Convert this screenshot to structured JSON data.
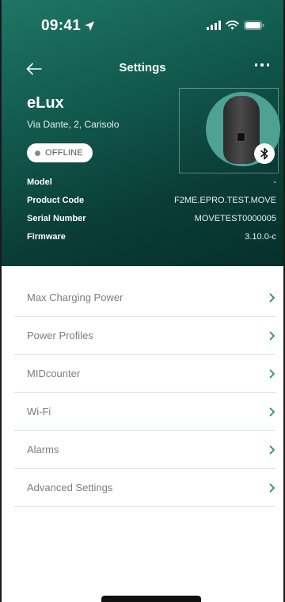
{
  "status_bar": {
    "time": "09:41",
    "icons": [
      "location-arrow-icon",
      "signal-icon",
      "wifi-icon",
      "battery-icon"
    ]
  },
  "navbar": {
    "title": "Settings",
    "back_icon": "back-arrow-icon",
    "more_icon": "more-dots-icon"
  },
  "device": {
    "name": "eLux",
    "address": "Via Dante, 2, Carisolo",
    "status": "OFFLINE",
    "status_color": "#8a8a8a",
    "badge_icon": "bluetooth-icon",
    "specs": [
      {
        "label": "Model",
        "value": "-"
      },
      {
        "label": "Product Code",
        "value": "F2ME.EPRO.TEST.MOVE"
      },
      {
        "label": "Serial Number",
        "value": "MOVETEST0000005"
      },
      {
        "label": "Firmware",
        "value": "3.10.0-c"
      }
    ]
  },
  "menu": {
    "items": [
      {
        "label": "Max Charging Power"
      },
      {
        "label": "Power Profiles"
      },
      {
        "label": "MIDcounter"
      },
      {
        "label": "Wi-Fi"
      },
      {
        "label": "Alarms"
      },
      {
        "label": "Advanced Settings"
      }
    ]
  },
  "colors": {
    "header_gradient_start": "#1f7565",
    "header_gradient_end": "#06302b",
    "accent": "#2a8a7a",
    "divider": "#dcebe8"
  }
}
